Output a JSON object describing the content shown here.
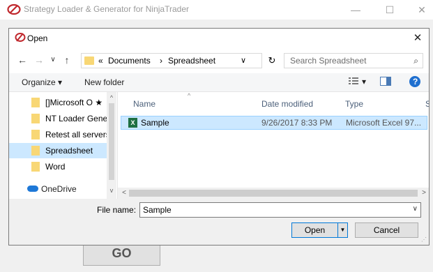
{
  "app": {
    "title": "Strategy Loader & Generator for NinjaTrader",
    "minimize": "—",
    "maximize": "☐",
    "close": "✕",
    "go_label": "GO"
  },
  "dialog": {
    "title": "Open",
    "close": "✕",
    "nav": {
      "back": "←",
      "forward": "→",
      "recent": "∨",
      "up": "↑",
      "breadcrumb_prefix": "«",
      "breadcrumb": [
        "Documents",
        "›",
        "Spreadsheet"
      ],
      "address_dropdown": "∨",
      "refresh": "↻",
      "search_placeholder": "Search Spreadsheet",
      "search_icon": "⌕"
    },
    "toolbar": {
      "organize": "Organize ▾",
      "new_folder": "New folder",
      "view_dropdown": "▾",
      "help": "?"
    },
    "nav_pane": {
      "items": [
        {
          "label": "[]Microsoft O ★",
          "selected": false
        },
        {
          "label": "NT Loader Gene",
          "selected": false
        },
        {
          "label": "Retest all servers",
          "selected": false
        },
        {
          "label": "Spreadsheet",
          "selected": true
        },
        {
          "label": "Word",
          "selected": false
        }
      ],
      "onedrive": "OneDrive",
      "scroll_up": "^",
      "scroll_down": "v"
    },
    "files": {
      "columns": [
        "Name",
        "Date modified",
        "Type",
        "S"
      ],
      "sort_indicator": "^",
      "rows": [
        {
          "name": "Sample",
          "date": "9/26/2017 8:33 PM",
          "type": "Microsoft Excel 97...",
          "icon": "X"
        }
      ],
      "hscroll_left": "<",
      "hscroll_right": ">"
    },
    "file_name_label": "File name:",
    "file_name_value": "Sample",
    "file_name_dropdown": "∨",
    "open_label": "Open",
    "open_split": "▼",
    "cancel_label": "Cancel",
    "grip": "⋰"
  },
  "colors": {
    "selection": "#cce8ff",
    "accent": "#0078d7",
    "folder": "#f8d775",
    "excel": "#1d6f42",
    "onedrive": "#1e78d7"
  }
}
